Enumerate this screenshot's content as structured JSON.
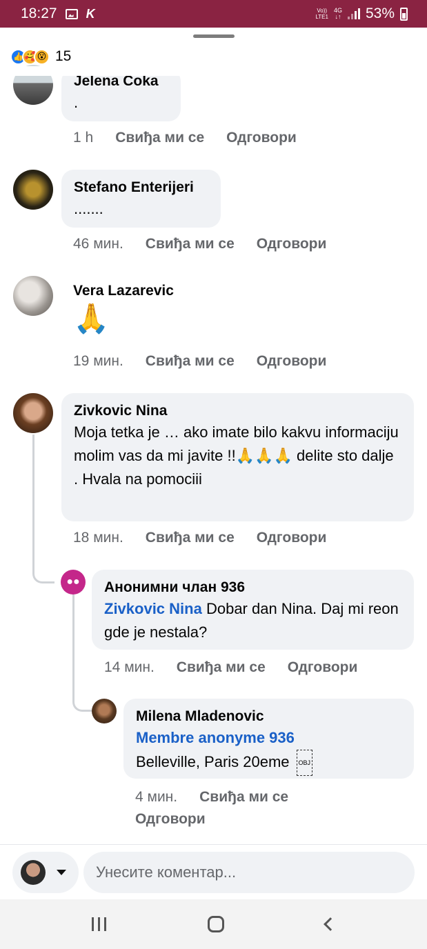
{
  "status_bar": {
    "time": "18:27",
    "app_indicator": "K",
    "volte": "Vo)) LTE1",
    "network": "4G",
    "battery": "53%"
  },
  "reactions": {
    "icons": [
      "like-icon",
      "care-icon",
      "wow-icon"
    ],
    "count": "15"
  },
  "comments": [
    {
      "name": "Jelena Coka",
      "text": ".",
      "time": "1 h",
      "like": "Свиђа ми се",
      "reply": "Одговори"
    },
    {
      "name": "Stefano Enterijeri",
      "text": ".......",
      "time": "46 мин.",
      "like": "Свиђа ми се",
      "reply": "Одговори"
    },
    {
      "name": "Vera Lazarevic",
      "text": "🙏",
      "time": "19 мин.",
      "like": "Свиђа ми се",
      "reply": "Одговори"
    },
    {
      "name": "Zivkovic Nina",
      "text": "Moja tetka je … ako imate bilo kakvu informaciju molim vas da mi javite !!🙏🙏🙏 delite sto dalje . Hvala na pomociii",
      "time": "18 мин.",
      "like": "Свиђа ми се",
      "reply": "Одговори"
    },
    {
      "name": "Анонимни члан 936",
      "mention": "Zivkovic Nina",
      "text": " Dobar dan Nina. Daj mi reon gde je nestala?",
      "time": "14 мин.",
      "like": "Свиђа ми се",
      "reply": "Одговори"
    },
    {
      "name": "Milena Mladenovic",
      "mention": "Membre anonyme 936",
      "text": "Belleville, Paris 20eme",
      "obj": "OBJ",
      "time": "4 мин.",
      "like": "Свиђа ми се",
      "reply": "Одговори"
    }
  ],
  "composer": {
    "placeholder": "Унесите коментар..."
  },
  "colors": {
    "status_bar": "#8a2342",
    "bubble": "#f0f2f5",
    "mention": "#1a60c7",
    "meta": "#65676b"
  }
}
